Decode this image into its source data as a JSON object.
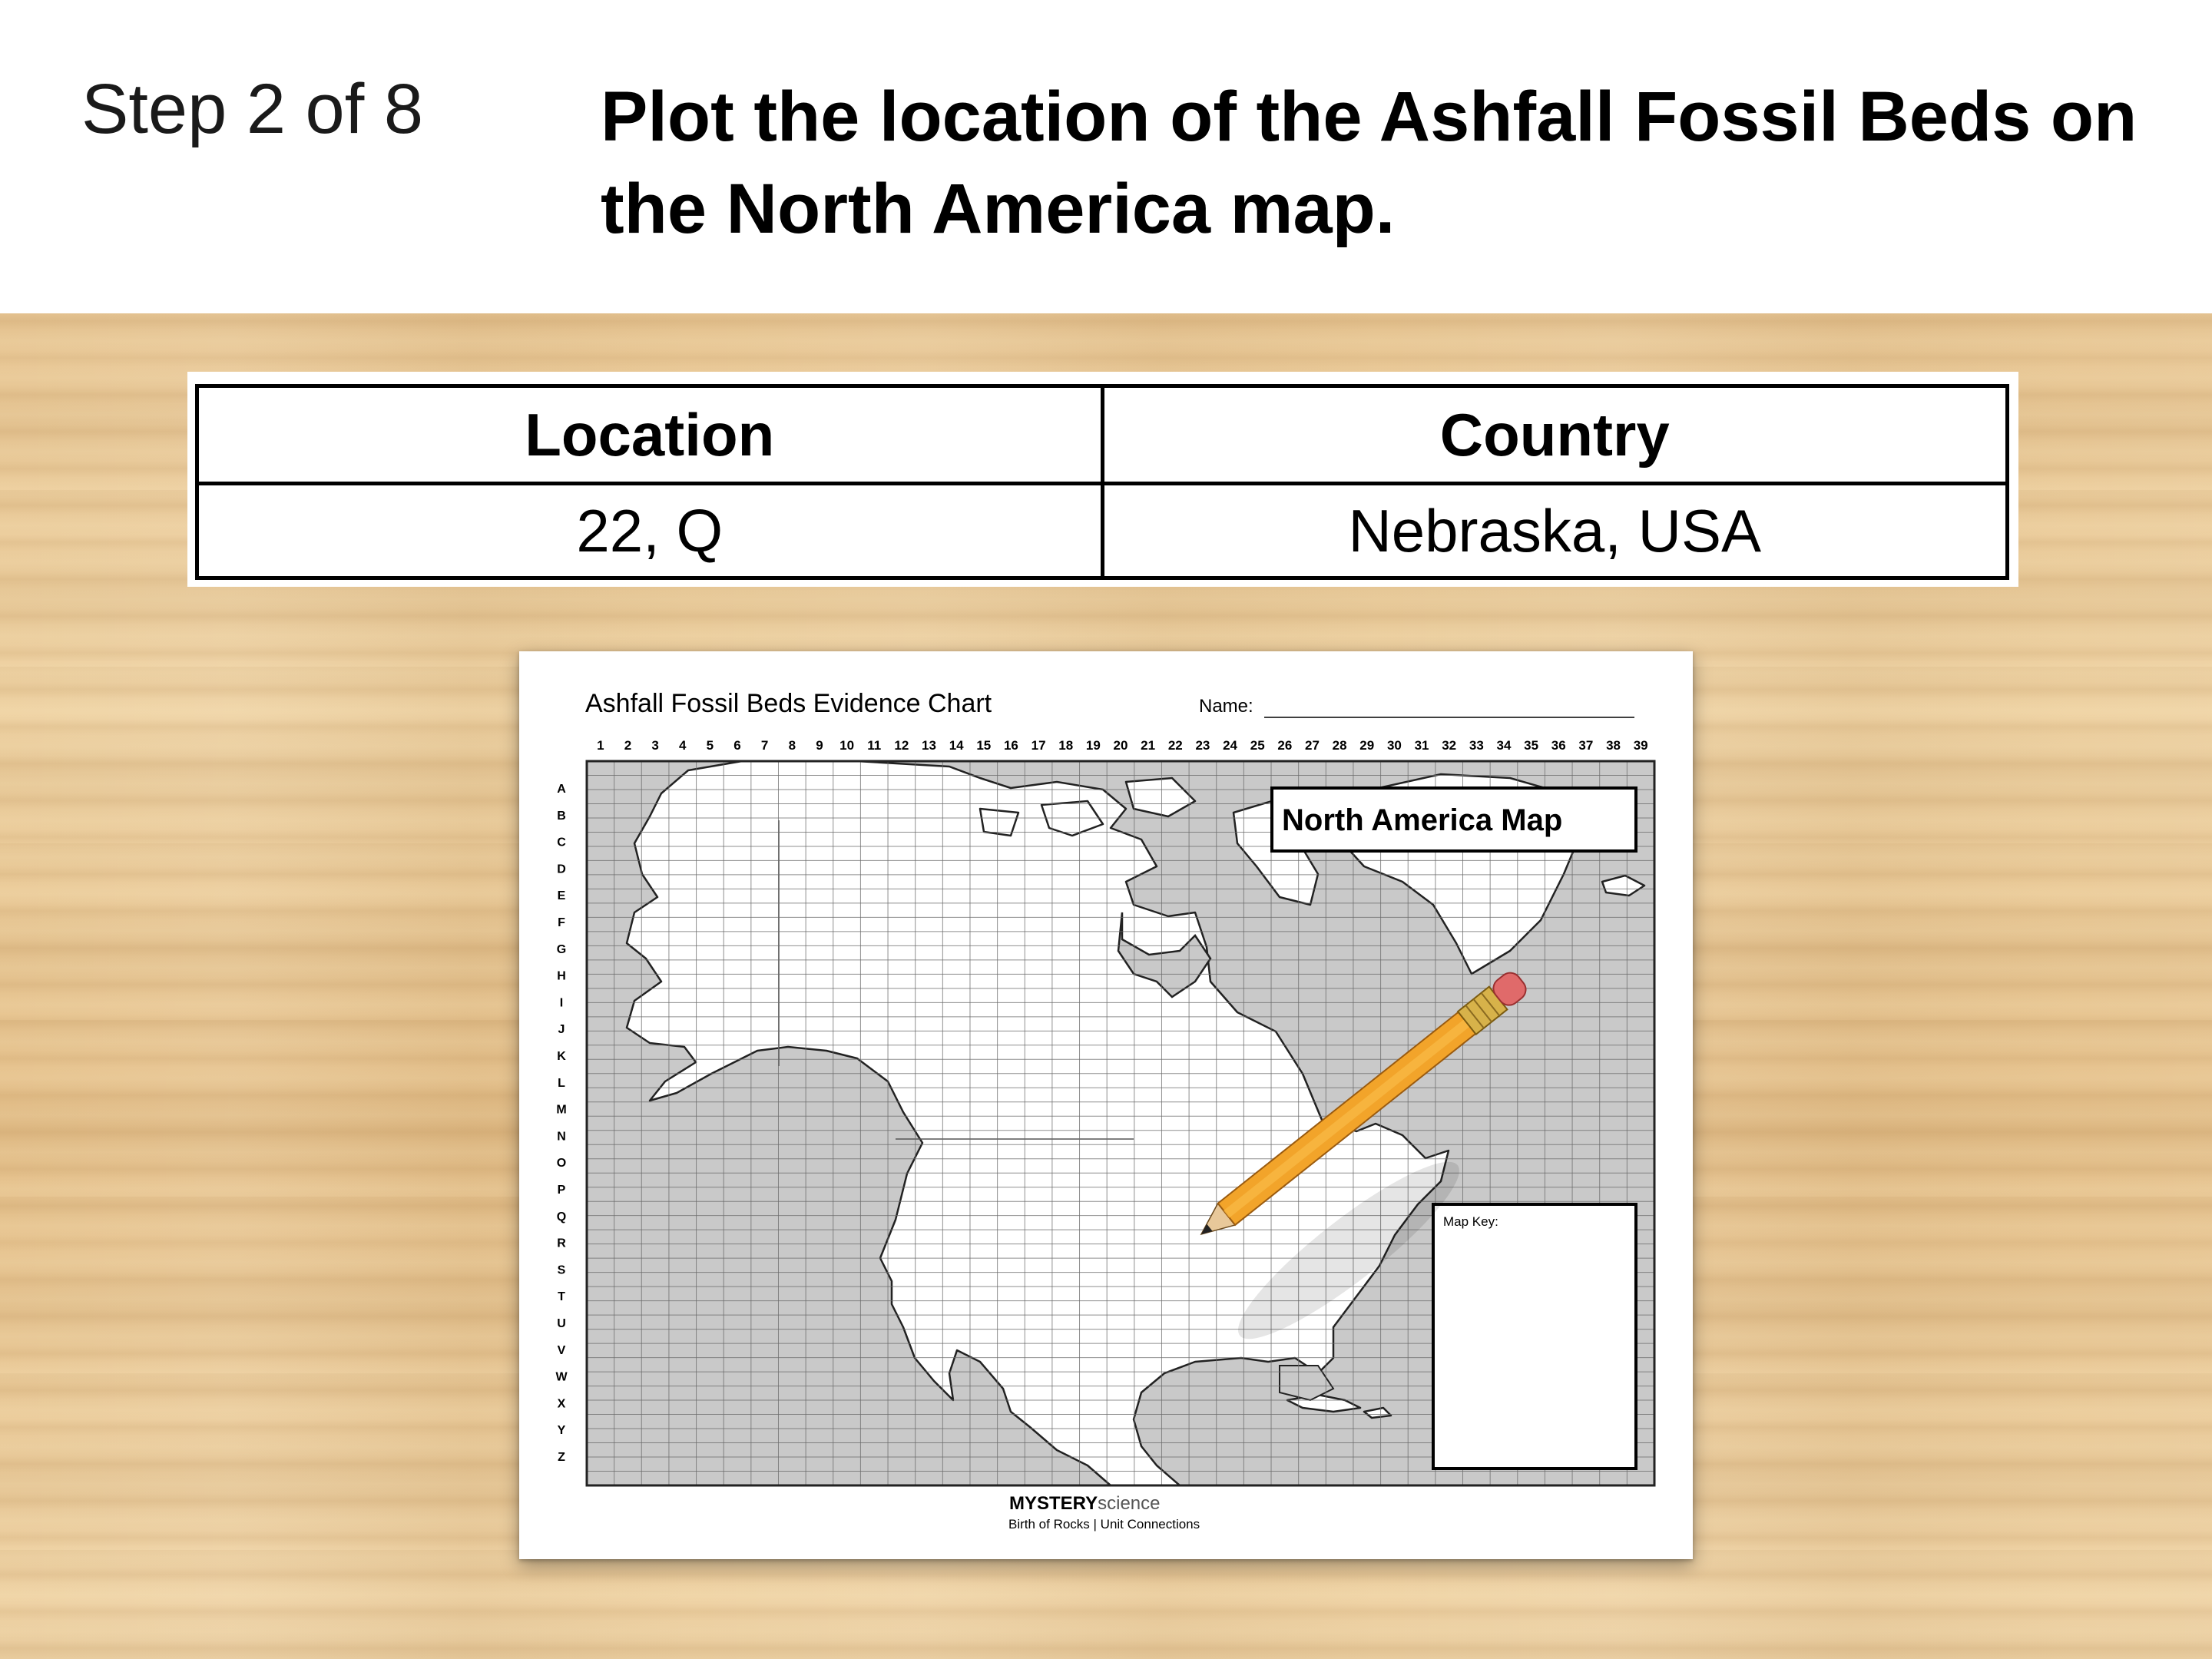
{
  "header": {
    "step": "Step 2 of 8",
    "instruction": "Plot the location of the Ashfall Fossil Beds on the North America map."
  },
  "info_table": {
    "columns": [
      "Location",
      "Country"
    ],
    "rows": [
      [
        "22, Q",
        "Nebraska, USA"
      ]
    ]
  },
  "worksheet": {
    "title": "Ashfall Fossil Beds Evidence Chart",
    "name_label": "Name:",
    "map_label": "North America Map",
    "map_key_label": "Map Key:",
    "column_labels": [
      "1",
      "2",
      "3",
      "4",
      "5",
      "6",
      "7",
      "8",
      "9",
      "10",
      "11",
      "12",
      "13",
      "14",
      "15",
      "16",
      "17",
      "18",
      "19",
      "20",
      "21",
      "22",
      "23",
      "24",
      "25",
      "26",
      "27",
      "28",
      "29",
      "30",
      "31",
      "32",
      "33",
      "34",
      "35",
      "36",
      "37",
      "38",
      "39"
    ],
    "row_labels": [
      "A",
      "B",
      "C",
      "D",
      "E",
      "F",
      "G",
      "H",
      "I",
      "J",
      "K",
      "L",
      "M",
      "N",
      "O",
      "P",
      "Q",
      "R",
      "S",
      "T",
      "U",
      "V",
      "W",
      "X",
      "Y",
      "Z"
    ],
    "footer_brand_bold": "MYSTERY",
    "footer_brand_light": "science",
    "footer_sub": "Birth of Rocks | Unit Connections"
  },
  "colors": {
    "ocean": "#c9c9c9",
    "land": "#ffffff",
    "grid": "#6a6a6a",
    "pencil_body": "#f2a42a",
    "pencil_eraser": "#e06a6a",
    "pencil_ferrule": "#d7b24a"
  },
  "icons": {
    "pencil": "pencil-icon"
  }
}
